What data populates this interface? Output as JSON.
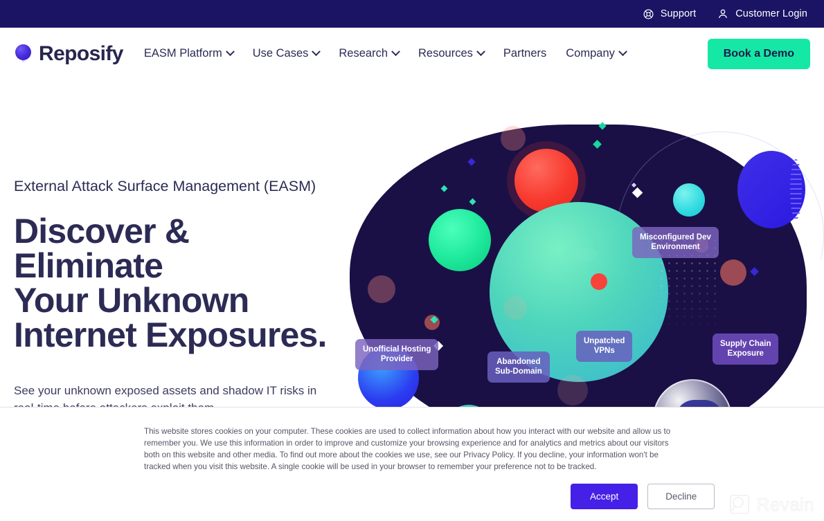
{
  "topbar": {
    "support": {
      "label": "Support",
      "icon": "lifebuoy-icon"
    },
    "login": {
      "label": "Customer Login",
      "icon": "user-icon"
    },
    "background": "#1b1464"
  },
  "header": {
    "logo_text": "Reposify",
    "logo_icon": "reposify-sphere-logo",
    "nav": [
      {
        "label": "EASM Platform",
        "has_dropdown": true
      },
      {
        "label": "Use Cases",
        "has_dropdown": true
      },
      {
        "label": "Research",
        "has_dropdown": true
      },
      {
        "label": "Resources",
        "has_dropdown": true
      },
      {
        "label": "Partners",
        "has_dropdown": false
      },
      {
        "label": "Company",
        "has_dropdown": true
      }
    ],
    "cta_label": "Book a Demo",
    "cta_color": "#15e8a5"
  },
  "hero": {
    "eyebrow": "External Attack Surface Management (EASM)",
    "headline_line1": "Discover & Eliminate",
    "headline_line2": "Your Unknown",
    "headline_line3": "Internet Exposures.",
    "subcopy": "See your unknown exposed assets and shadow IT risks in real-time before attackers exploit them.",
    "text_color": "#2b2b55"
  },
  "illustration": {
    "tags": [
      {
        "line1": "Misconfigured Dev",
        "line2": "Environment"
      },
      {
        "line1": "Unofficial Hosting",
        "line2": "Provider"
      },
      {
        "line1": "Unpatched",
        "line2": "VPNs"
      },
      {
        "line1": "Abandoned",
        "line2": "Sub-Domain"
      },
      {
        "line1": "Supply Chain",
        "line2": "Exposure"
      },
      {
        "line1": "",
        "line2": ""
      }
    ],
    "robot": "robot-astronaut-illustration",
    "flag": "blue-flag-illustration",
    "blob_color": "#1a1046"
  },
  "cookie": {
    "text": "This website stores cookies on your computer. These cookies are used to collect information about how you interact with our website and allow us to remember you. We use this information in order to improve and customize your browsing experience and for analytics and metrics about our visitors both on this website and other media. To find out more about the cookies we use, see our Privacy Policy. If you decline, your information won't be tracked when you visit this website. A single cookie will be used in your browser to remember your preference not to be tracked.",
    "accept_label": "Accept",
    "decline_label": "Decline",
    "accept_color": "#4520e6"
  },
  "watermark": {
    "label": "Revain",
    "icon": "magnifier-icon"
  }
}
